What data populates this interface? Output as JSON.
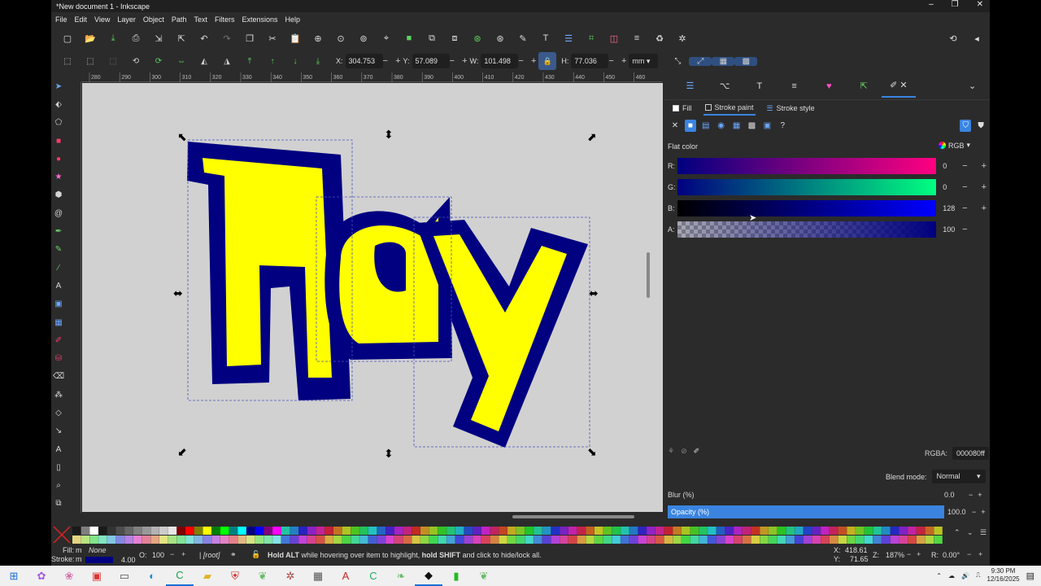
{
  "window": {
    "title": "*New document 1 - Inkscape",
    "controls": [
      "–",
      "❐",
      "✕"
    ]
  },
  "menu": [
    "File",
    "Edit",
    "View",
    "Layer",
    "Object",
    "Path",
    "Text",
    "Filters",
    "Extensions",
    "Help"
  ],
  "commands": [
    "new-icon",
    "open-icon",
    "save-icon",
    "print-icon",
    "import-icon",
    "export-icon",
    "undo-icon",
    "redo-icon",
    "copy-icon",
    "cut-icon",
    "paste-icon",
    "zoom-selection-icon",
    "zoom-drawing-icon",
    "zoom-page-icon",
    "zoom-center-icon",
    "duplicate-icon",
    "clone-icon",
    "unlink-clone-icon",
    "group-icon",
    "ungroup-icon",
    "edit-path-icon",
    "text-icon",
    "layers-icon",
    "xml-icon",
    "objects-icon",
    "align-icon",
    "symbols-icon",
    "preferences-icon"
  ],
  "transform": {
    "x_label": "X:",
    "x": "304.753",
    "y_label": "Y:",
    "y": "57.089",
    "w_label": "W:",
    "w": "101.498",
    "h_label": "H:",
    "h": "77.036",
    "units": "mm"
  },
  "ruler": {
    "top_ticks": [
      "280",
      "290",
      "300",
      "310",
      "320",
      "330",
      "340",
      "350",
      "360",
      "370",
      "380",
      "390",
      "400",
      "410",
      "420",
      "430",
      "440",
      "450",
      "460"
    ]
  },
  "canvas": {
    "art_text": "Hay",
    "fill_color": "#ffff00",
    "stroke_color": "#000080"
  },
  "panel": {
    "tabs": [
      "Fill",
      "Stroke paint",
      "Stroke style"
    ],
    "flat_color_label": "Flat color",
    "color_mode": "RGB",
    "sliders": [
      {
        "label": "R:",
        "value": "0"
      },
      {
        "label": "G:",
        "value": "0"
      },
      {
        "label": "B:",
        "value": "128"
      },
      {
        "label": "A:",
        "value": "100"
      }
    ],
    "rgba_label": "RGBA:",
    "rgba_value": "000080ff",
    "blend_label": "Blend mode:",
    "blend_value": "Normal",
    "blur_label": "Blur (%)",
    "blur_value": "0.0",
    "opacity_label": "Opacity (%)",
    "opacity_value": "100.0",
    "unknown_btn": "?"
  },
  "status": {
    "fill_label": "Fill:",
    "fill_value": "m",
    "stroke_label": "Stroke:",
    "stroke_value": "m",
    "none_label": "None",
    "stroke_width": "4.00",
    "o_label": "O:",
    "opacity": "100",
    "layer": "[root]",
    "message_b1": "Hold ALT",
    "message_t1": " while hovering over item to highlight, ",
    "message_b2": "hold SHIFT",
    "message_t2": " and click to hide/lock all.",
    "cursor_x": "418.61",
    "cursor_y": "71.65",
    "x_label": "X:",
    "y_label": "Y:",
    "zoom_label": "Z:",
    "zoom": "187%",
    "rot_label": "R:",
    "rotation": "0.00°"
  },
  "taskbar": {
    "time": "9:30 PM",
    "date": "12/16/2025"
  }
}
